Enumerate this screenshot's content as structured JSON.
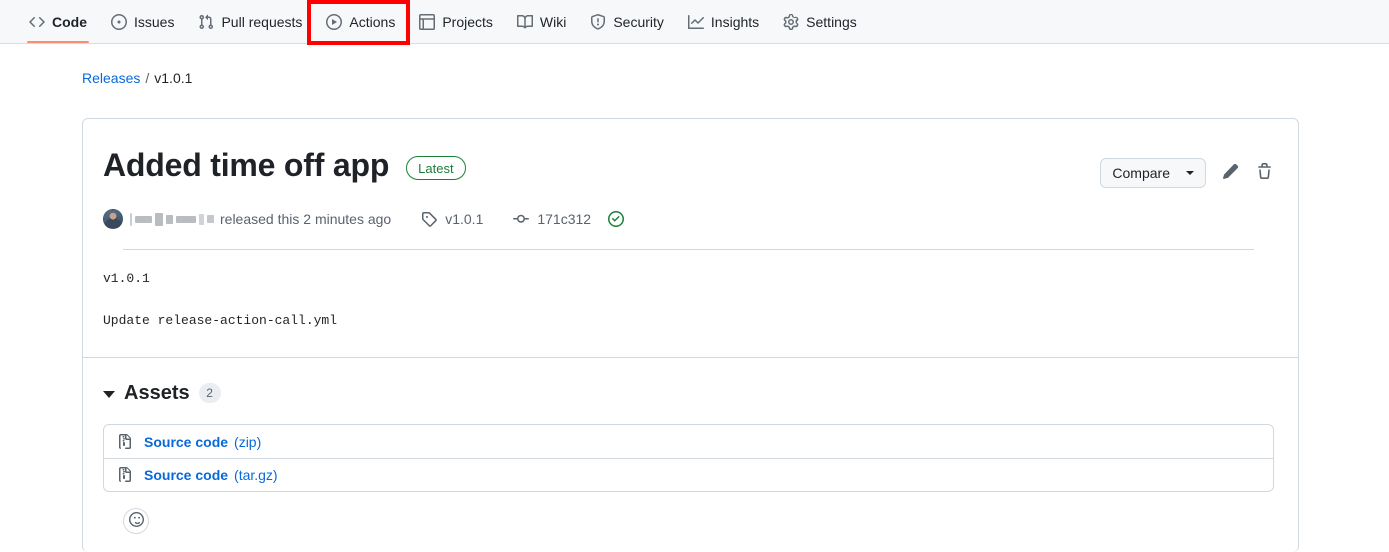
{
  "nav": {
    "items": [
      {
        "label": "Code",
        "icon": "code-icon",
        "active": true
      },
      {
        "label": "Issues",
        "icon": "issue-opened-icon",
        "active": false
      },
      {
        "label": "Pull requests",
        "icon": "git-pull-request-icon",
        "active": false
      },
      {
        "label": "Actions",
        "icon": "play-icon",
        "active": false,
        "highlighted": true
      },
      {
        "label": "Projects",
        "icon": "table-icon",
        "active": false
      },
      {
        "label": "Wiki",
        "icon": "book-icon",
        "active": false
      },
      {
        "label": "Security",
        "icon": "shield-icon",
        "active": false
      },
      {
        "label": "Insights",
        "icon": "graph-icon",
        "active": false
      },
      {
        "label": "Settings",
        "icon": "gear-icon",
        "active": false
      }
    ]
  },
  "breadcrumb": {
    "root_label": "Releases",
    "separator": "/",
    "current_label": "v1.0.1"
  },
  "release": {
    "title": "Added time off app",
    "latest_badge": "Latest",
    "author_name_redacted": true,
    "released_text": "released this 2 minutes ago",
    "tag_label": "v1.0.1",
    "commit_sha": "171c312",
    "verified_icon": "verified-check-icon",
    "body_lines": [
      "v1.0.1",
      "Update release-action-call.yml"
    ]
  },
  "actions": {
    "compare_label": "Compare",
    "edit_icon": "pencil-icon",
    "delete_icon": "trash-icon"
  },
  "assets": {
    "title": "Assets",
    "count": "2",
    "expanded": true,
    "items": [
      {
        "name": "Source code",
        "ext": "(zip)",
        "icon": "file-zip-icon"
      },
      {
        "name": "Source code",
        "ext": "(tar.gz)",
        "icon": "file-zip-icon"
      }
    ]
  },
  "reactions": {
    "add_reaction_icon": "smiley-icon"
  },
  "colors": {
    "accent_link": "#0969da",
    "active_tab_underline": "#fd8c73",
    "latest_badge": "#1a7f37",
    "highlight_box": "#ff0000",
    "nav_background": "#f6f8fa",
    "border": "#d1d9e0"
  }
}
